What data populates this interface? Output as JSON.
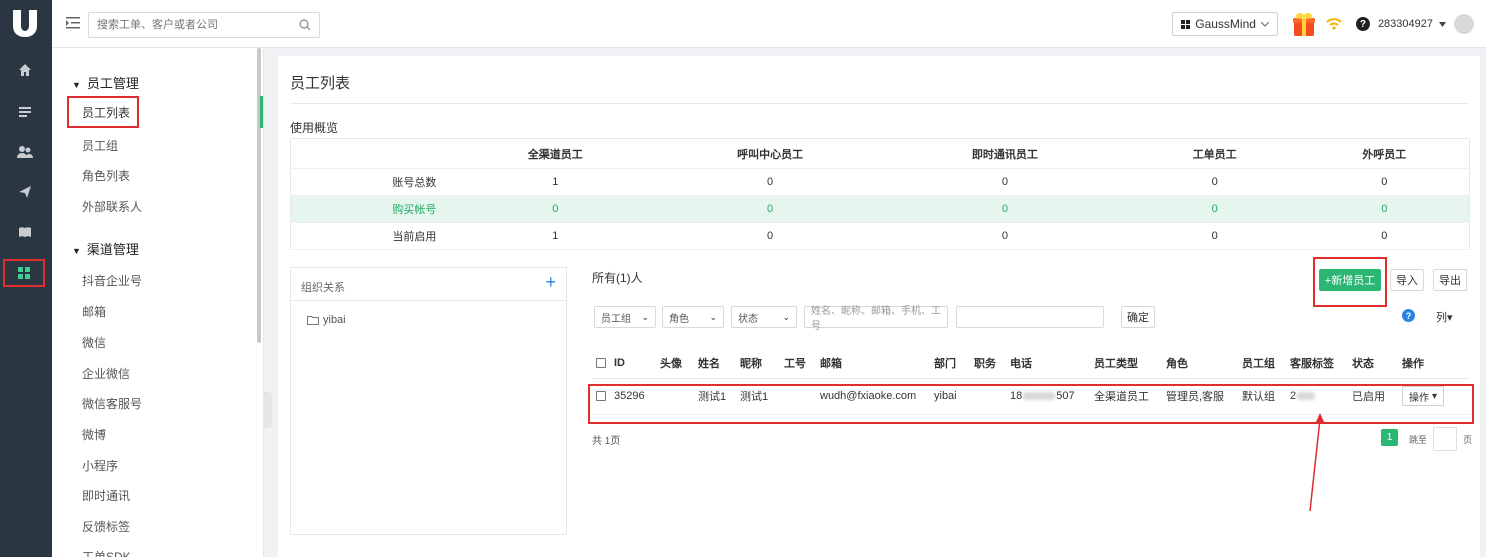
{
  "topbar": {
    "search_placeholder": "搜索工单、客户或者公司",
    "product_name": "GaussMind",
    "user_id": "283304927"
  },
  "rail": {
    "icons": [
      "logo-icon",
      "home-icon",
      "list-icon",
      "users-icon",
      "send-icon",
      "book-icon",
      "apps-icon"
    ]
  },
  "subnav": {
    "group1": "员工管理",
    "group1_items": [
      "员工列表",
      "员工组",
      "角色列表",
      "外部联系人"
    ],
    "group2": "渠道管理",
    "group2_items": [
      "抖音企业号",
      "邮箱",
      "微信",
      "企业微信",
      "微信客服号",
      "微博",
      "小程序",
      "即时通讯",
      "反馈标签",
      "工单SDK"
    ]
  },
  "main": {
    "page_title": "员工列表",
    "usage_label": "使用概览",
    "usage_columns": [
      "全渠道员工",
      "呼叫中心员工",
      "即时通讯员工",
      "工单员工",
      "外呼员工"
    ],
    "usage_rows": [
      {
        "label": "账号总数",
        "values": [
          "1",
          "0",
          "0",
          "0",
          "0"
        ]
      },
      {
        "label": "购买帐号",
        "values": [
          "0",
          "0",
          "0",
          "0",
          "0"
        ]
      },
      {
        "label": "当前启用",
        "values": [
          "1",
          "0",
          "0",
          "0",
          "0"
        ]
      }
    ],
    "org_title": "组织关系",
    "org_root": "yibai",
    "emp_count": "所有(1)人",
    "buttons": {
      "new_employee": "+新增员工",
      "import": "导入",
      "export": "导出",
      "confirm": "确定",
      "columns": "列"
    },
    "filters": {
      "group": "员工组",
      "role": "角色",
      "status": "状态",
      "search_placeholder": "姓名、昵称、邮箱、手机、工号"
    },
    "table_headers": [
      "ID",
      "头像",
      "姓名",
      "昵称",
      "工号",
      "邮箱",
      "部门",
      "职务",
      "电话",
      "员工类型",
      "角色",
      "员工组",
      "客服标签",
      "状态",
      "操作"
    ],
    "row": {
      "id": "35296",
      "name": "测试1",
      "nickname": "测试1",
      "email": "wudh@fxiaoke.com",
      "dept": "yibai",
      "phone_prefix": "18",
      "phone_suffix": "507",
      "type": "全渠道员工",
      "role": "管理员,客服",
      "group": "默认组",
      "tag_prefix": "2",
      "status": "已启用",
      "op": "操作"
    },
    "pages_total": "共 1页",
    "current_page": "1",
    "jump_label": "跳至",
    "page_unit": "页"
  },
  "colors": {
    "accent": "#2bb673",
    "annotation": "#e02d2d",
    "rail": "#2b3643",
    "link": "#2a82e4"
  }
}
